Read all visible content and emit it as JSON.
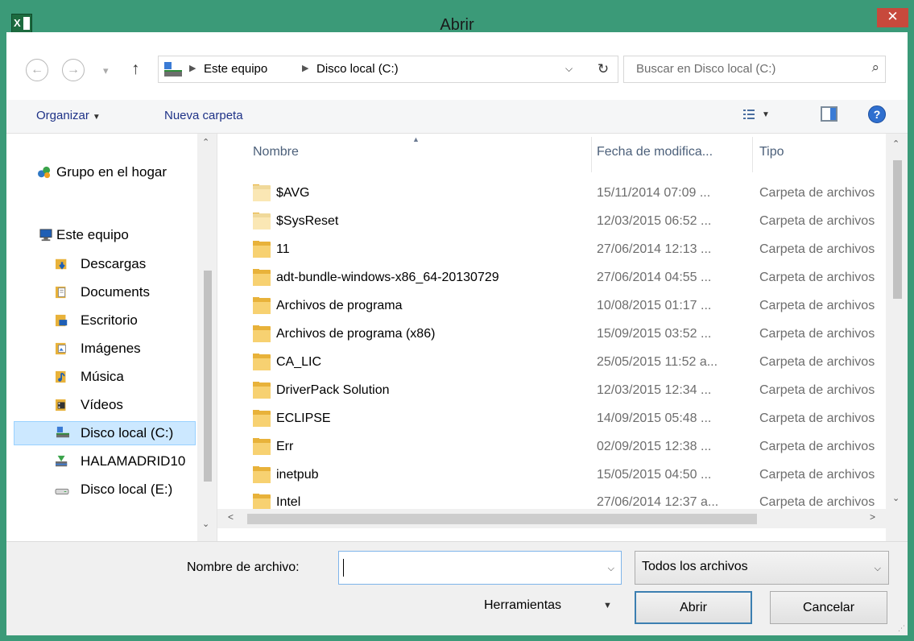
{
  "window": {
    "title": "Abrir",
    "app_icon": "excel-icon",
    "close_symbol": "✕"
  },
  "nav": {
    "back_symbol": "←",
    "forward_symbol": "→",
    "recent_symbol": "▾",
    "up_symbol": "↑",
    "breadcrumb": [
      "Este equipo",
      "Disco local (C:)"
    ],
    "breadcrumb_sep": "▶",
    "dropdown_symbol": "⌵",
    "refresh_symbol": "↻",
    "search_placeholder": "Buscar en Disco local (C:)",
    "search_symbol": "⌕"
  },
  "toolbar": {
    "organize_label": "Organizar",
    "organize_caret": "▼",
    "new_folder_label": "Nueva carpeta",
    "view_caret": "▼",
    "help_label": "?"
  },
  "navpane": {
    "items": [
      {
        "label": "Grupo en el hogar",
        "icon": "homegroup-icon"
      },
      {
        "label": "Este equipo",
        "icon": "computer-icon"
      },
      {
        "label": "Descargas",
        "icon": "downloads-icon"
      },
      {
        "label": "Documents",
        "icon": "documents-icon"
      },
      {
        "label": "Escritorio",
        "icon": "desktop-icon"
      },
      {
        "label": "Imágenes",
        "icon": "pictures-icon"
      },
      {
        "label": "Música",
        "icon": "music-icon"
      },
      {
        "label": "Vídeos",
        "icon": "videos-icon"
      },
      {
        "label": "Disco local (C:)",
        "icon": "drive-c-icon"
      },
      {
        "label": "HALAMADRID10",
        "icon": "network-drive-icon"
      },
      {
        "label": "Disco local (E:)",
        "icon": "drive-e-icon"
      }
    ],
    "selected": "Disco local (C:)"
  },
  "filelist": {
    "columns": [
      "Nombre",
      "Fecha de modifica...",
      "Tipo"
    ],
    "sort_indicator": "▲",
    "rows": [
      {
        "name": "$AVG",
        "date": "15/11/2014 07:09 ...",
        "type": "Carpeta de archivos"
      },
      {
        "name": "$SysReset",
        "date": "12/03/2015 06:52 ...",
        "type": "Carpeta de archivos"
      },
      {
        "name": "11",
        "date": "27/06/2014 12:13 ...",
        "type": "Carpeta de archivos"
      },
      {
        "name": "adt-bundle-windows-x86_64-20130729",
        "date": "27/06/2014 04:55 ...",
        "type": "Carpeta de archivos"
      },
      {
        "name": "Archivos de programa",
        "date": "10/08/2015 01:17 ...",
        "type": "Carpeta de archivos"
      },
      {
        "name": "Archivos de programa (x86)",
        "date": "15/09/2015 03:52 ...",
        "type": "Carpeta de archivos"
      },
      {
        "name": "CA_LIC",
        "date": "25/05/2015 11:52 a...",
        "type": "Carpeta de archivos"
      },
      {
        "name": "DriverPack Solution",
        "date": "12/03/2015 12:34 ...",
        "type": "Carpeta de archivos"
      },
      {
        "name": "ECLIPSE",
        "date": "14/09/2015 05:48 ...",
        "type": "Carpeta de archivos"
      },
      {
        "name": "Err",
        "date": "02/09/2015 12:38 ...",
        "type": "Carpeta de archivos"
      },
      {
        "name": "inetpub",
        "date": "15/05/2015 04:50 ...",
        "type": "Carpeta de archivos"
      },
      {
        "name": "Intel",
        "date": "27/06/2014 12:37 a...",
        "type": "Carpeta de archivos"
      }
    ]
  },
  "scroll": {
    "up": "⌃",
    "down": "⌄",
    "left": "<",
    "right": ">"
  },
  "bottom": {
    "filename_label": "Nombre de archivo:",
    "filename_value": "",
    "filename_drop": "⌵",
    "filter_value": "Todos los archivos",
    "filter_drop": "⌵",
    "tools_label": "Herramientas",
    "tools_caret": "▼",
    "open_label": "Abrir",
    "cancel_label": "Cancelar"
  },
  "colors": {
    "frame": "#3b9a78",
    "close": "#c7493c",
    "selected": "#cce8ff",
    "link": "#1e3287"
  }
}
